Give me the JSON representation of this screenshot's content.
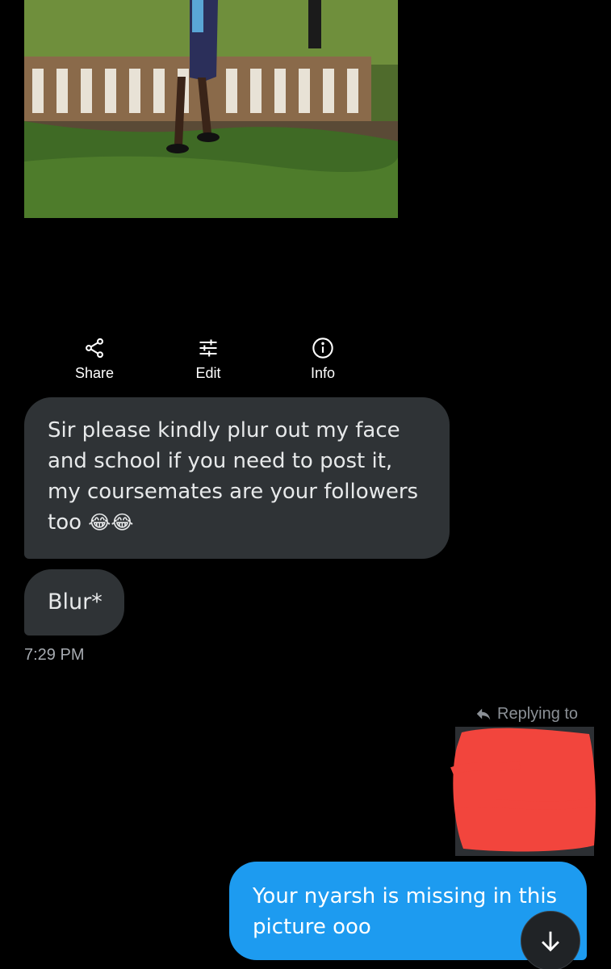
{
  "media_actions": {
    "share_label": "Share",
    "edit_label": "Edit",
    "info_label": "Info",
    "share_icon": "share-icon",
    "edit_icon": "sliders-icon",
    "info_icon": "info-icon"
  },
  "messages": [
    {
      "direction": "incoming",
      "text": "Sir please kindly plur out my face and school if you need to post it, my coursemates are your followers too",
      "emoji": "😂😂"
    },
    {
      "direction": "incoming",
      "text": "Blur*"
    },
    {
      "direction": "outgoing",
      "text": "Your nyarsh is missing in this picture ooo"
    }
  ],
  "timestamp": "7:29 PM",
  "reply_indicator": {
    "label": "Replying to"
  },
  "colors": {
    "background": "#000000",
    "incoming_bubble": "#2f3336",
    "outgoing_bubble": "#1d9bf0",
    "redaction": "#f2453d"
  },
  "scroll_button_icon": "arrow-down-icon"
}
